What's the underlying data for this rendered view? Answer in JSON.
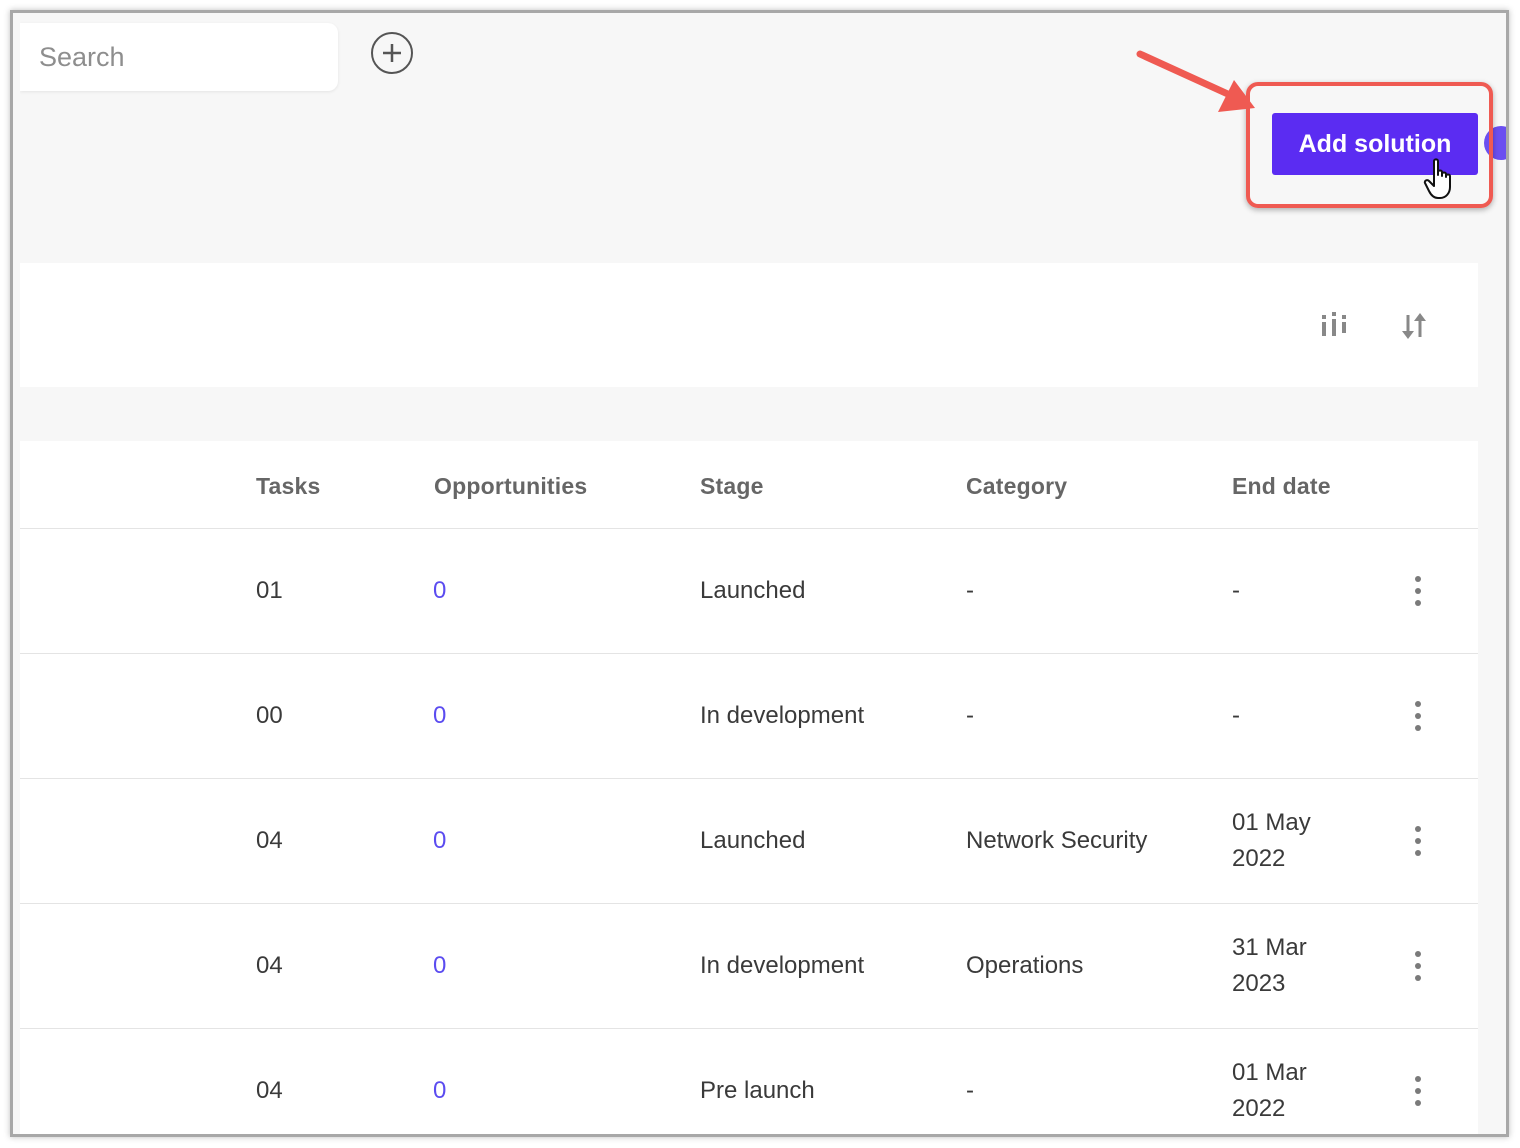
{
  "search": {
    "placeholder": "Search"
  },
  "header": {
    "add_button_label": "Add solution"
  },
  "colors": {
    "accent": "#5b2cf2",
    "link": "#5b4cf0",
    "annotation": "#ef5a52"
  },
  "toolbar": {
    "icons": [
      "columns-icon",
      "sort-icon"
    ]
  },
  "table": {
    "columns": [
      "Tasks",
      "Opportunities",
      "Stage",
      "Category",
      "End date"
    ],
    "rows": [
      {
        "tasks": "01",
        "opportunities": "0",
        "stage": "Launched",
        "category": "-",
        "end_date": "-"
      },
      {
        "tasks": "00",
        "opportunities": "0",
        "stage": "In development",
        "category": "-",
        "end_date": "-"
      },
      {
        "tasks": "04",
        "opportunities": "0",
        "stage": "Launched",
        "category": "Network Security",
        "end_date": "01 May 2022"
      },
      {
        "tasks": "04",
        "opportunities": "0",
        "stage": "In development",
        "category": "Operations",
        "end_date": "31 Mar 2023"
      },
      {
        "tasks": "04",
        "opportunities": "0",
        "stage": "Pre launch",
        "category": "-",
        "end_date": "01 Mar 2022"
      }
    ]
  }
}
